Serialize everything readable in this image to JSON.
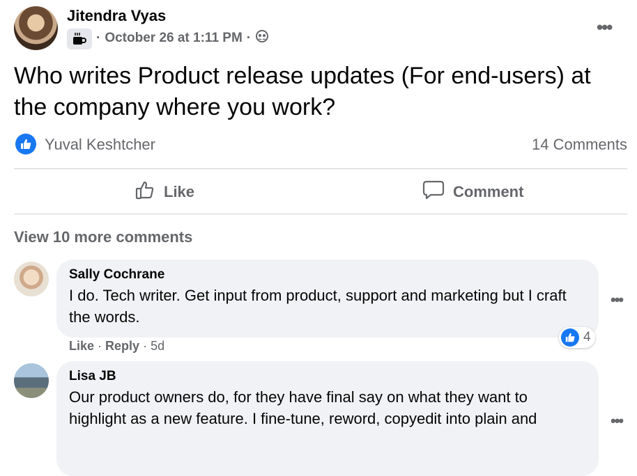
{
  "post": {
    "author": "Jitendra Vyas",
    "timestamp": "October 26 at 1:11 PM",
    "separator": "·",
    "text": "Who writes Product release updates (For end-users) at the company where you work?",
    "privacy_icon": "friends-icon",
    "group_icon": "coffee-cup-icon"
  },
  "reactions": {
    "liker": "Yuval Keshtcher",
    "comment_count": "14 Comments"
  },
  "actions": {
    "like_label": "Like",
    "comment_label": "Comment"
  },
  "view_more": "View 10 more comments",
  "comments": [
    {
      "name": "Sally Cochrane",
      "text": "I do. Tech writer. Get input from product, support and marketing but I craft the words.",
      "like_label": "Like",
      "reply_label": "Reply",
      "age": "5d",
      "reaction_count": "4"
    },
    {
      "name": "Lisa JB",
      "text": "Our product owners do, for they have final say on what they want to highlight as a new feature. I fine-tune, reword, copyedit into plain and"
    }
  ],
  "colors": {
    "accent": "#1877f2",
    "muted": "#65676b",
    "bubble": "#f0f2f5"
  }
}
